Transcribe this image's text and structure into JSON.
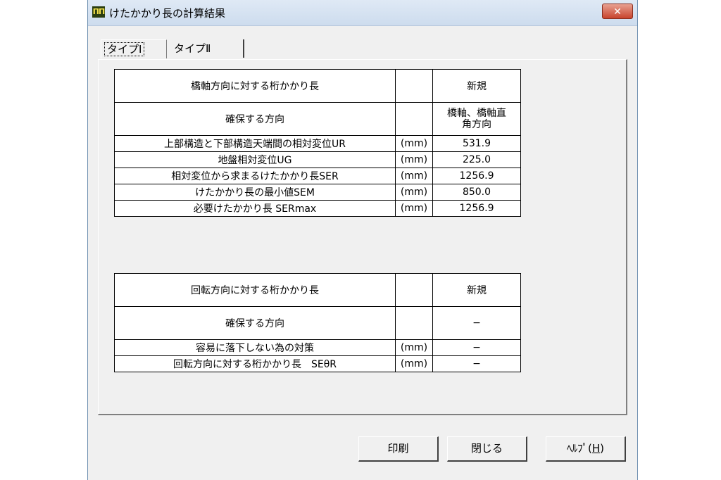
{
  "window": {
    "title": "けたかかり長の計算結果",
    "icon_text": "ΠΠ",
    "close_symbol": "✕"
  },
  "tabs": [
    {
      "label": "タイプⅠ",
      "active": true
    },
    {
      "label": "タイプⅡ",
      "active": false
    }
  ],
  "table1": {
    "header": {
      "label": "橋軸方向に対する桁かかり長",
      "unit": "",
      "value": "新規"
    },
    "direction": {
      "label": "確保する方向",
      "unit": "",
      "value_line1": "橋軸、橋軸直",
      "value_line2": "角方向"
    },
    "rows": [
      {
        "label": "上部構造と下部構造天端間の相対変位UR",
        "unit": "(mm)",
        "value": "531.9"
      },
      {
        "label": "地盤相対変位UG",
        "unit": "(mm)",
        "value": "225.0"
      },
      {
        "label": "相対変位から求まるけたかかり長SER",
        "unit": "(mm)",
        "value": "1256.9"
      },
      {
        "label": "けたかかり長の最小値SEM",
        "unit": "(mm)",
        "value": "850.0"
      },
      {
        "label": "必要けたかかり長 SERmax",
        "unit": "(mm)",
        "value": "1256.9"
      }
    ]
  },
  "table2": {
    "header": {
      "label": "回転方向に対する桁かかり長",
      "unit": "",
      "value": "新規"
    },
    "direction": {
      "label": "確保する方向",
      "unit": "",
      "value": "−"
    },
    "rows": [
      {
        "label": "容易に落下しない為の対策",
        "unit": "(mm)",
        "value": "−"
      },
      {
        "label": "回転方向に対する桁かかり長　SEθR",
        "unit": "(mm)",
        "value": "−"
      }
    ]
  },
  "buttons": {
    "print": "印刷",
    "close": "閉じる",
    "help_prefix": "ﾍﾙﾌﾟ(",
    "help_key": "H",
    "help_suffix": ")"
  }
}
